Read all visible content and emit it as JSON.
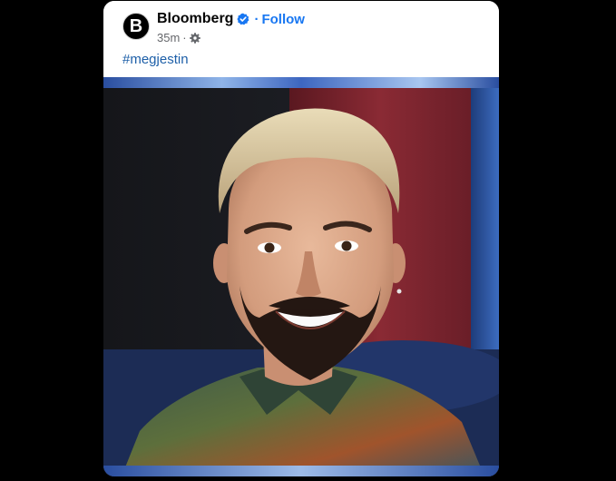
{
  "post": {
    "author": {
      "avatar_letter": "B",
      "name": "Bloomberg",
      "verified": true
    },
    "follow_label": "Follow",
    "separator": "·",
    "timestamp": "35m",
    "privacy_icon": "settings-icon",
    "hashtag": "#megjestin",
    "media": {
      "type": "photo"
    }
  },
  "colors": {
    "background": "#000000",
    "card": "#ffffff",
    "link_blue": "#1877f2",
    "hashtag_blue": "#1d5fa8",
    "meta_gray": "#65676b"
  }
}
